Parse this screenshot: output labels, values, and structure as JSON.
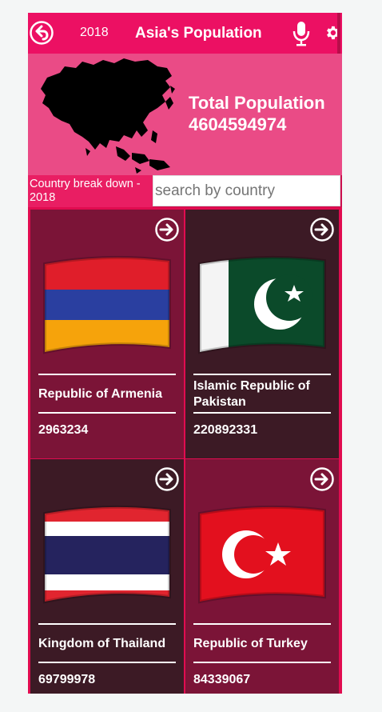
{
  "header": {
    "year": "2018",
    "title": "Asia's Population",
    "icons": {
      "back": "back-arrow-icon",
      "mic": "microphone-icon",
      "settings": "gear-icon"
    }
  },
  "banner": {
    "label": "Total Population",
    "value": "4604594974"
  },
  "breakdown_label": "Country break down - 2018",
  "search": {
    "placeholder": "search by country",
    "value": ""
  },
  "countries": [
    {
      "name": "Republic of Armenia",
      "population": "2963234",
      "flag": "armenia-flag"
    },
    {
      "name": "Islamic Republic of Pakistan",
      "population": "220892331",
      "flag": "pakistan-flag"
    },
    {
      "name": "Kingdom of Thailand",
      "population": "69799978",
      "flag": "thailand-flag"
    },
    {
      "name": "Republic of Turkey",
      "population": "84339067",
      "flag": "turkey-flag"
    }
  ],
  "colors": {
    "header": "#ec1063",
    "banner": "#ea4b86",
    "card_light": "#7b1437",
    "card_dark": "#3c1a25"
  }
}
